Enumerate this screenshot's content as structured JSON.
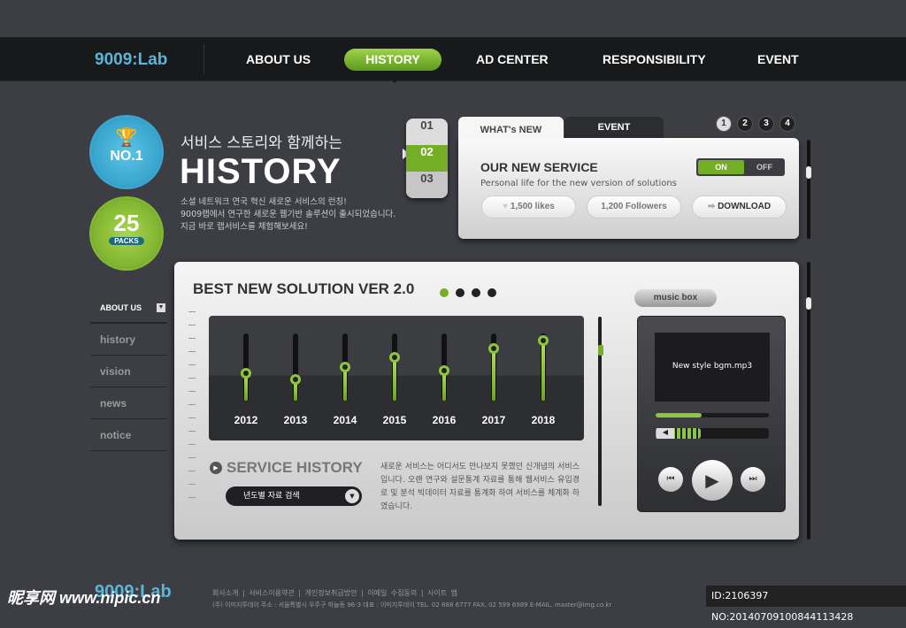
{
  "nav": {
    "logo": "9009:Lab",
    "items": [
      "ABOUT US",
      "HISTORY",
      "AD CENTER",
      "RESPONSIBILITY",
      "EVENT"
    ],
    "active": "HISTORY"
  },
  "badges": {
    "no1": "NO.1",
    "packs_num": "25",
    "packs": "PACKS"
  },
  "hero": {
    "subtitle": "서비스 스토리와 함께하는",
    "title": "HISTORY",
    "lines": [
      "소셜 네트워크 연국 혁신 새로운 서비스의 런칭!",
      "9009랩에서 연구한 새로운 웹기반 솔루션이 출시되었습니다.",
      "지금 바로 랩서비스를 체험해보세요!"
    ]
  },
  "numtabs": [
    "01",
    "02",
    "03"
  ],
  "numtabs_active": "02",
  "card": {
    "tabs": [
      "WHAT's NEW",
      "EVENT"
    ],
    "title": "OUR NEW SERVICE",
    "desc": "Personal life for the new version of solutions",
    "toggle_on": "ON",
    "toggle_off": "OFF",
    "likes": "1,500 likes",
    "followers": "1,200 Followers",
    "download": "DOWNLOAD"
  },
  "pager": [
    "1",
    "2",
    "3",
    "4"
  ],
  "sidebar": {
    "header": "ABOUT US",
    "items": [
      "history",
      "vision",
      "news",
      "notice"
    ]
  },
  "main": {
    "title": "BEST NEW SOLUTION VER 2.0",
    "service_title": "SERVICE HISTORY",
    "select": "년도별 자료 검색",
    "text": "새로운 서비스는 어디서도 만나보지 못했던 신개념의 서비스입니다. 오랜 연구와 설문통계 자료를 통해 웹서비스 유입경로 및 분석 빅데이터 자료를 통계화 하여 서비스를 체계화 하였습니다."
  },
  "sliders": [
    {
      "year": "2012",
      "level": 0.41
    },
    {
      "year": "2013",
      "level": 0.31
    },
    {
      "year": "2014",
      "level": 0.5
    },
    {
      "year": "2015",
      "level": 0.64
    },
    {
      "year": "2016",
      "level": 0.45
    },
    {
      "year": "2017",
      "level": 0.77
    },
    {
      "year": "2018",
      "level": 0.89
    }
  ],
  "music": {
    "label": "music box",
    "track": "New style bgm.mp3",
    "progress": 0.41,
    "volume": 0.4
  },
  "footer": {
    "logo": "9009:Lab",
    "links": [
      "회사소개",
      "서비스이용약관",
      "개인정보취급방안",
      "이메일 수집동의",
      "사이트 맵"
    ],
    "address": "(주) 이미지투데이    주소 : 서울특별시 우주구 하늘동 96-3  대표 : 이미지투데이  TEL. 02 888 6777  FAX. 02 599 6989 E-MAIL. master@img.co.kr"
  },
  "watermark": {
    "site": "昵享网 www.nipic.cn",
    "id": "ID:2106397 NO:20140709100844113428"
  },
  "colors": {
    "green": "#74ad26",
    "blue": "#5ab5d8"
  }
}
